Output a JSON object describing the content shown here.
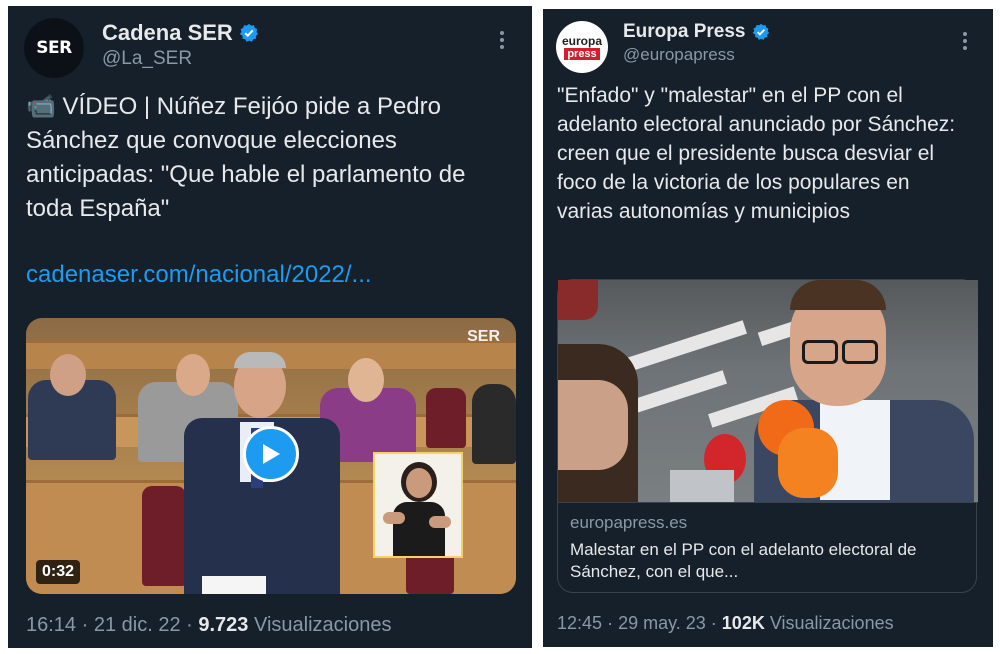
{
  "tweets": [
    {
      "author": {
        "display_name": "Cadena SER",
        "handle": "@La_SER",
        "avatar_text": "SER",
        "verified": true
      },
      "text": "📹 VÍDEO | Núñez Feijóo pide a Pedro Sánchez que convoque elecciones anticipadas: \"Que hable el parlamento de toda España\"",
      "link_text": "cadenaser.com/nacional/2022/...",
      "media": {
        "type": "video",
        "duration": "0:32",
        "watermark": "SER"
      },
      "footer": {
        "time": "16:14",
        "date": "21 dic. 22",
        "views_count": "9.723",
        "views_label": "Visualizaciones"
      }
    },
    {
      "author": {
        "display_name": "Europa Press",
        "handle": "@europapress",
        "avatar_text_top": "europa",
        "avatar_text_bottom": "press",
        "verified": true
      },
      "text": "\"Enfado\" y \"malestar\" en el PP con el adelanto electoral anunciado por Sánchez: creen que el presidente busca desviar el foco de la victoria de los populares en varias autonomías y municipios",
      "media": {
        "type": "link-card",
        "domain": "europapress.es",
        "title": "Malestar en el PP con el adelanto electoral de Sánchez, con el que..."
      },
      "footer": {
        "time": "12:45",
        "date": "29 may. 23",
        "views_count": "102K",
        "views_label": "Visualizaciones"
      }
    }
  ],
  "colors": {
    "background": "#15202b",
    "text": "#e7e9ea",
    "muted": "#8b98a5",
    "accent": "#1d9bf0",
    "verified": "#1d9bf0"
  },
  "icons": {
    "verified": "verified-badge-icon",
    "more": "more-options-icon",
    "play": "play-icon",
    "video_camera": "video-camera-icon"
  }
}
